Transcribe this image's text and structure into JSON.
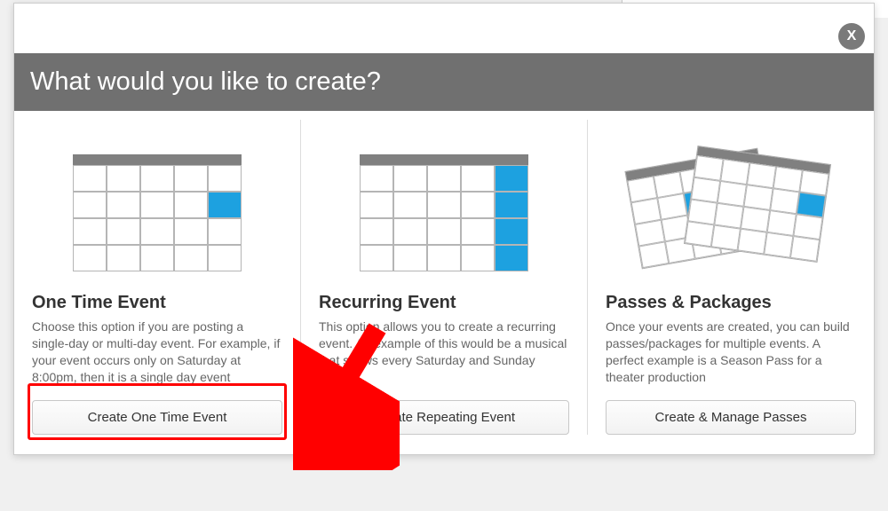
{
  "modal": {
    "title": "What would you like to create?",
    "close_label": "X"
  },
  "options": {
    "one_time": {
      "title": "One Time Event",
      "desc": "Choose this option if you are posting a single-day or multi-day event. For example, if your event occurs only on Saturday at 8:00pm, then it is a single day event",
      "button": "Create One Time Event"
    },
    "recurring": {
      "title": "Recurring Event",
      "desc": "This option allows you to create a recurring event. An example of this would be a musical that shows every Saturday and Sunday",
      "button": "Create Repeating Event"
    },
    "passes": {
      "title": "Passes & Packages",
      "desc": "Once your events are created, you can build passes/packages for multiple events. A perfect example is a Season Pass for a theater production",
      "button": "Create & Manage Passes"
    }
  }
}
